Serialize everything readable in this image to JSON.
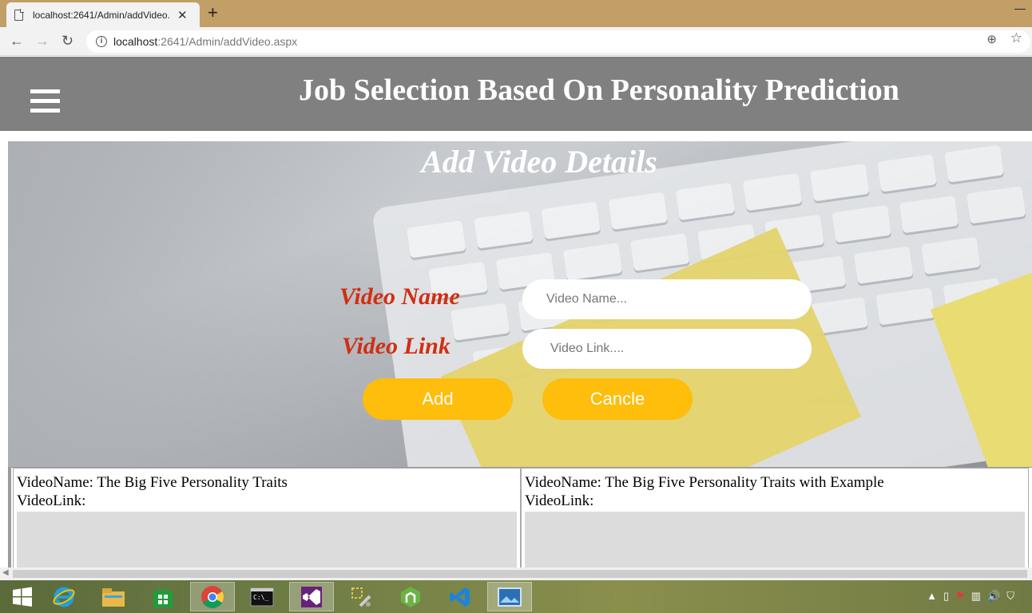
{
  "browser": {
    "tab_title": "localhost:2641/Admin/addVideo.",
    "tab_close": "✕",
    "new_tab": "+",
    "url_host": "localhost",
    "url_path": ":2641/Admin/addVideo.aspx"
  },
  "header": {
    "title": "Job Selection Based On Personality Prediction"
  },
  "form": {
    "title": "Add Video Details",
    "video_name_label": "Video Name",
    "video_name_placeholder": "Video Name...",
    "video_link_label": "Video Link",
    "video_link_placeholder": "Video Link....",
    "add_label": "Add",
    "cancel_label": "Cancle"
  },
  "videos": [
    {
      "name_line": "VideoName: The Big Five Personality Traits",
      "link_line": "VideoLink:"
    },
    {
      "name_line": "VideoName: The Big Five Personality Traits with Example",
      "link_line": "VideoLink:"
    }
  ],
  "colors": {
    "header_bg": "#808080",
    "label_red": "#d02e12",
    "button_yellow": "#ffbd0c",
    "tabstrip": "#c19f66"
  },
  "taskbar": {
    "apps": [
      "windows-start",
      "internet-explorer",
      "file-explorer",
      "store",
      "chrome",
      "command-prompt",
      "visual-studio",
      "tools",
      "android-studio",
      "vscode",
      "photos"
    ]
  }
}
